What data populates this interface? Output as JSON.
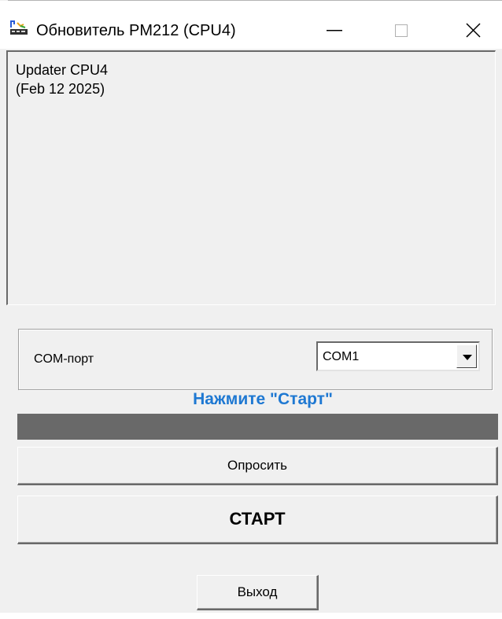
{
  "window": {
    "title": "Обновитель PM212 (CPU4)",
    "icon": "updater-app-icon",
    "minimize_icon": "minimize-icon",
    "maximize_icon": "maximize-icon",
    "close_icon": "close-icon"
  },
  "log": {
    "lines": [
      "Updater CPU4",
      "(Feb 12 2025)"
    ]
  },
  "com": {
    "label": "COM-порт",
    "selected": "COM1",
    "dropdown_icon": "chevron-down-icon"
  },
  "status": {
    "text": "Нажмите \"Старт\"",
    "color": "#1e78d2"
  },
  "progress": {
    "value": 0,
    "track_color": "#696969"
  },
  "buttons": {
    "poll": "Опросить",
    "start": "СТАРТ",
    "exit": "Выход"
  }
}
